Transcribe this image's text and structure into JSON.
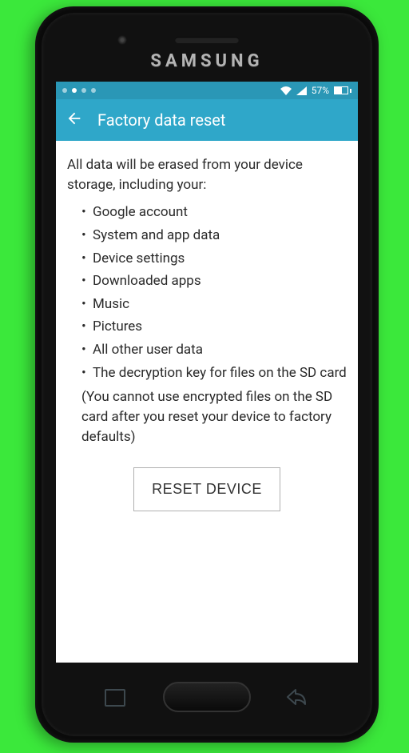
{
  "statusbar": {
    "battery_text": "57%"
  },
  "appbar": {
    "title": "Factory data reset"
  },
  "content": {
    "intro": "All data will be erased from your device storage, including your:",
    "items": [
      "Google account",
      "System and app data",
      "Device settings",
      "Downloaded apps",
      "Music",
      "Pictures",
      "All other user data"
    ],
    "sd_line": "The decryption key for files on the SD card",
    "sd_note": "(You cannot use encrypted files on the SD card after you reset your device to factory defaults)"
  },
  "button": {
    "reset": "RESET DEVICE"
  },
  "brand": "SAMSUNG"
}
